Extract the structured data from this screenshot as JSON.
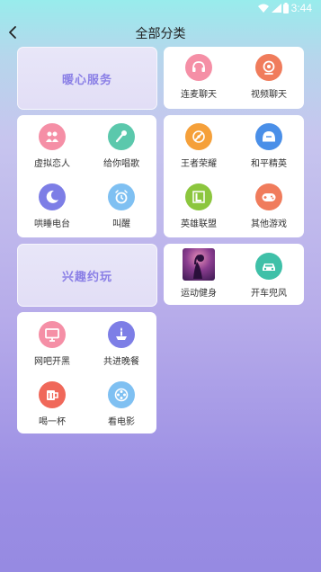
{
  "status": {
    "time": "3:44"
  },
  "header": {
    "title": "全部分类"
  },
  "sections": {
    "warm": {
      "banner": "暖心服务"
    },
    "fun": {
      "banner": "兴趣约玩"
    }
  },
  "items": {
    "lianmai": "连麦聊天",
    "shipin": "视频聊天",
    "xuni": "虚拟恋人",
    "changge": "给你唱歌",
    "wangzhe": "王者荣耀",
    "heping": "和平精英",
    "hongshui": "哄睡电台",
    "jiaoxing": "叫醒",
    "yingxiong": "英雄联盟",
    "qita": "其他游戏",
    "yundong": "运动健身",
    "kaiche": "开车兜风",
    "wangba": "网吧开黑",
    "wancan": "共进晚餐",
    "hejiu": "喝一杯",
    "dianying": "看电影"
  },
  "colors": {
    "pink": "#f58fa6",
    "green": "#5bc8ac",
    "orange": "#f5a03a",
    "blue": "#4a8fe8",
    "purple": "#7d7ee6",
    "lightblue": "#7fc0f2",
    "olive": "#8cc63e",
    "coral": "#f07c5c",
    "redorange": "#f0685a",
    "teal": "#3fc0a8",
    "banner_text": "#8a7fe6"
  }
}
